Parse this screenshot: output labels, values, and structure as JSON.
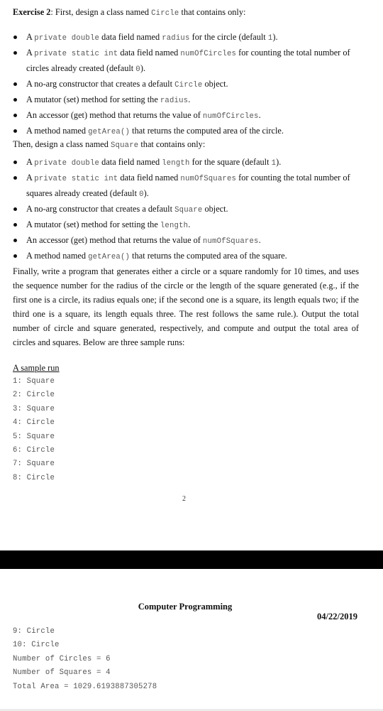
{
  "page1": {
    "exercise_label": "Exercise 2",
    "intro_circle": {
      "before": ": First, design a class named ",
      "code": "Circle",
      "after": " that contains only:"
    },
    "circle_items": [
      {
        "parts": [
          [
            "t",
            "A "
          ],
          [
            "c",
            "private double"
          ],
          [
            "t",
            " data field named "
          ],
          [
            "c",
            "radius"
          ],
          [
            "t",
            " for the circle (default "
          ],
          [
            "c",
            "1"
          ],
          [
            "t",
            ")."
          ]
        ]
      },
      {
        "parts": [
          [
            "t",
            "A "
          ],
          [
            "c",
            "private static int"
          ],
          [
            "t",
            " data field named "
          ],
          [
            "c",
            "numOfCircles"
          ],
          [
            "t",
            " for counting the total number of circles already created (default "
          ],
          [
            "c",
            "0"
          ],
          [
            "t",
            ")."
          ]
        ]
      },
      {
        "parts": [
          [
            "t",
            "A no-arg constructor that creates a default "
          ],
          [
            "c",
            "Circle"
          ],
          [
            "t",
            " object."
          ]
        ]
      },
      {
        "parts": [
          [
            "t",
            "A mutator (set) method for setting the "
          ],
          [
            "c",
            "radius"
          ],
          [
            "t",
            "."
          ]
        ]
      },
      {
        "parts": [
          [
            "t",
            "An accessor (get) method that returns the value of "
          ],
          [
            "c",
            "numOfCircles"
          ],
          [
            "t",
            "."
          ]
        ]
      },
      {
        "parts": [
          [
            "t",
            "A method named "
          ],
          [
            "c",
            "getArea()"
          ],
          [
            "t",
            " that returns the computed area of the circle."
          ]
        ]
      }
    ],
    "intro_square": {
      "before": "Then, design a class named ",
      "code": "Square",
      "after": " that contains only:"
    },
    "square_items": [
      {
        "parts": [
          [
            "t",
            "A "
          ],
          [
            "c",
            "private double"
          ],
          [
            "t",
            " data field named "
          ],
          [
            "c",
            "length"
          ],
          [
            "t",
            " for the square (default "
          ],
          [
            "c",
            "1"
          ],
          [
            "t",
            ")."
          ]
        ]
      },
      {
        "parts": [
          [
            "t",
            "A "
          ],
          [
            "c",
            "private static int"
          ],
          [
            "t",
            " data field named "
          ],
          [
            "c",
            "numOfSquares"
          ],
          [
            "t",
            " for counting the total number of squares already created (default "
          ],
          [
            "c",
            "0"
          ],
          [
            "t",
            ")."
          ]
        ]
      },
      {
        "parts": [
          [
            "t",
            "A no-arg constructor that creates a default "
          ],
          [
            "c",
            "Square"
          ],
          [
            "t",
            " object."
          ]
        ]
      },
      {
        "parts": [
          [
            "t",
            "A mutator (set) method for setting the "
          ],
          [
            "c",
            "length"
          ],
          [
            "t",
            "."
          ]
        ]
      },
      {
        "parts": [
          [
            "t",
            "An accessor (get) method that returns the value of "
          ],
          [
            "c",
            "numOfSquares"
          ],
          [
            "t",
            "."
          ]
        ]
      },
      {
        "parts": [
          [
            "t",
            "A method named "
          ],
          [
            "c",
            "getArea()"
          ],
          [
            "t",
            " that returns the computed area of the square."
          ]
        ]
      }
    ],
    "final_paragraph": "Finally, write a program that generates either a circle or a square randomly for 10 times, and uses the sequence number for the radius of the circle or the length of the square generated (e.g., if the first one is a circle, its radius equals one; if the second one is a square, its length equals two; if the third one is a square, its length equals three. The rest follows the same rule.). Output the total number of circle and square generated, respectively, and compute and output the total area of circles and squares. Below are three sample runs:",
    "sample_title": "A sample run",
    "sample_lines": [
      "1: Square",
      "2: Circle",
      "3: Square",
      "4: Circle",
      "5: Square",
      "6: Circle",
      "7: Square",
      "8: Circle"
    ],
    "page_number": "2"
  },
  "page2": {
    "header_title": "Computer Programming",
    "header_date": "04/22/2019",
    "sample_lines": [
      "9: Circle",
      "10: Circle",
      "Number of Circles = 6",
      "Number of Squares = 4",
      "Total Area = 1029.6193887305278"
    ]
  }
}
